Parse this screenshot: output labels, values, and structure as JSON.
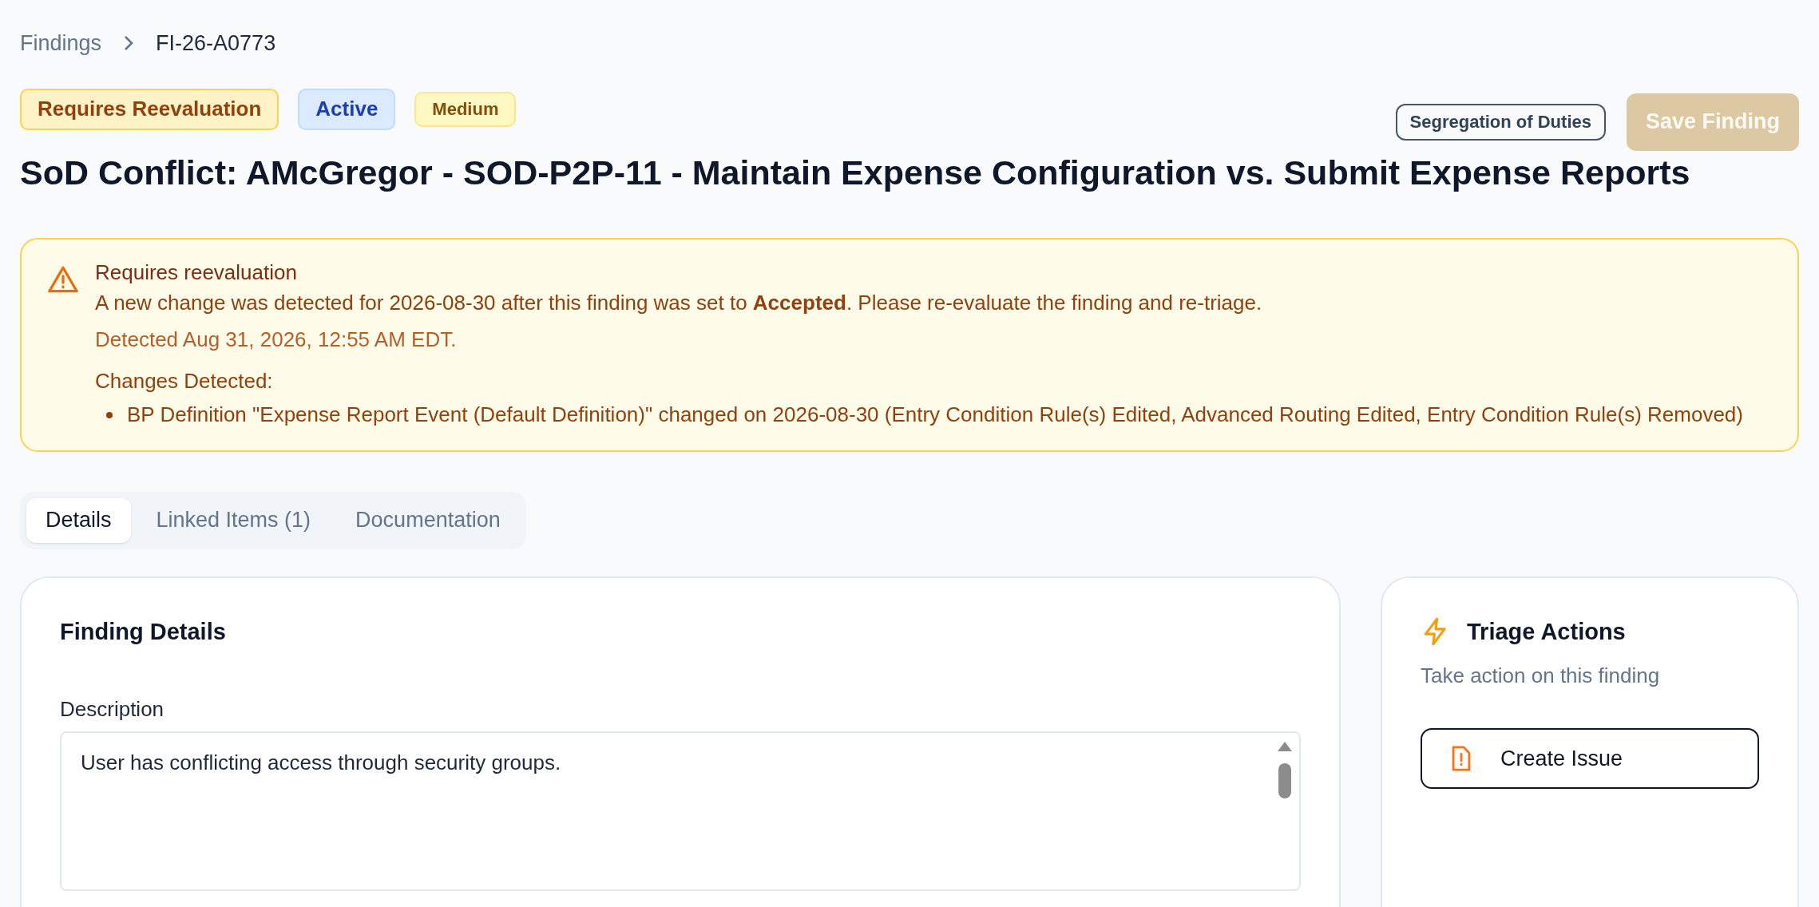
{
  "breadcrumb": {
    "parent": "Findings",
    "current": "FI-26-A0773"
  },
  "badges": [
    {
      "label": "Requires Reevaluation",
      "kind": "reevaluation"
    },
    {
      "label": "Active",
      "kind": "status"
    },
    {
      "label": "Medium",
      "kind": "severity"
    }
  ],
  "category_tag": "Segregation of Duties",
  "save_button": {
    "label": "Save Finding",
    "disabled": true
  },
  "title": "SoD Conflict: AMcGregor - SOD-P2P-11 - Maintain Expense Configuration vs. Submit Expense Reports",
  "alert": {
    "title": "Requires reevaluation",
    "message": "A new change was detected for 2026-08-30 after this finding was set to **Accepted**. Please re-evaluate the finding and re-triage.",
    "detected": "Detected Aug 31, 2026, 12:55 AM EDT.",
    "changes_heading": "Changes Detected:",
    "changes": [
      "BP Definition \"Expense Report Event (Default Definition)\" changed on 2026-08-30 (Entry Condition Rule(s) Edited, Advanced Routing Edited, Entry Condition Rule(s) Removed)"
    ]
  },
  "tabs": [
    {
      "label": "Details",
      "selected": true
    },
    {
      "label": "Linked Items (1)",
      "selected": false
    },
    {
      "label": "Documentation",
      "selected": false
    }
  ],
  "details_card": {
    "title": "Finding Details",
    "description_label": "Description",
    "description": "User has conflicting access through security groups."
  },
  "triage_card": {
    "title": "Triage Actions",
    "subtitle": "Take action on this finding",
    "actions": [
      "Create Issue"
    ]
  }
}
